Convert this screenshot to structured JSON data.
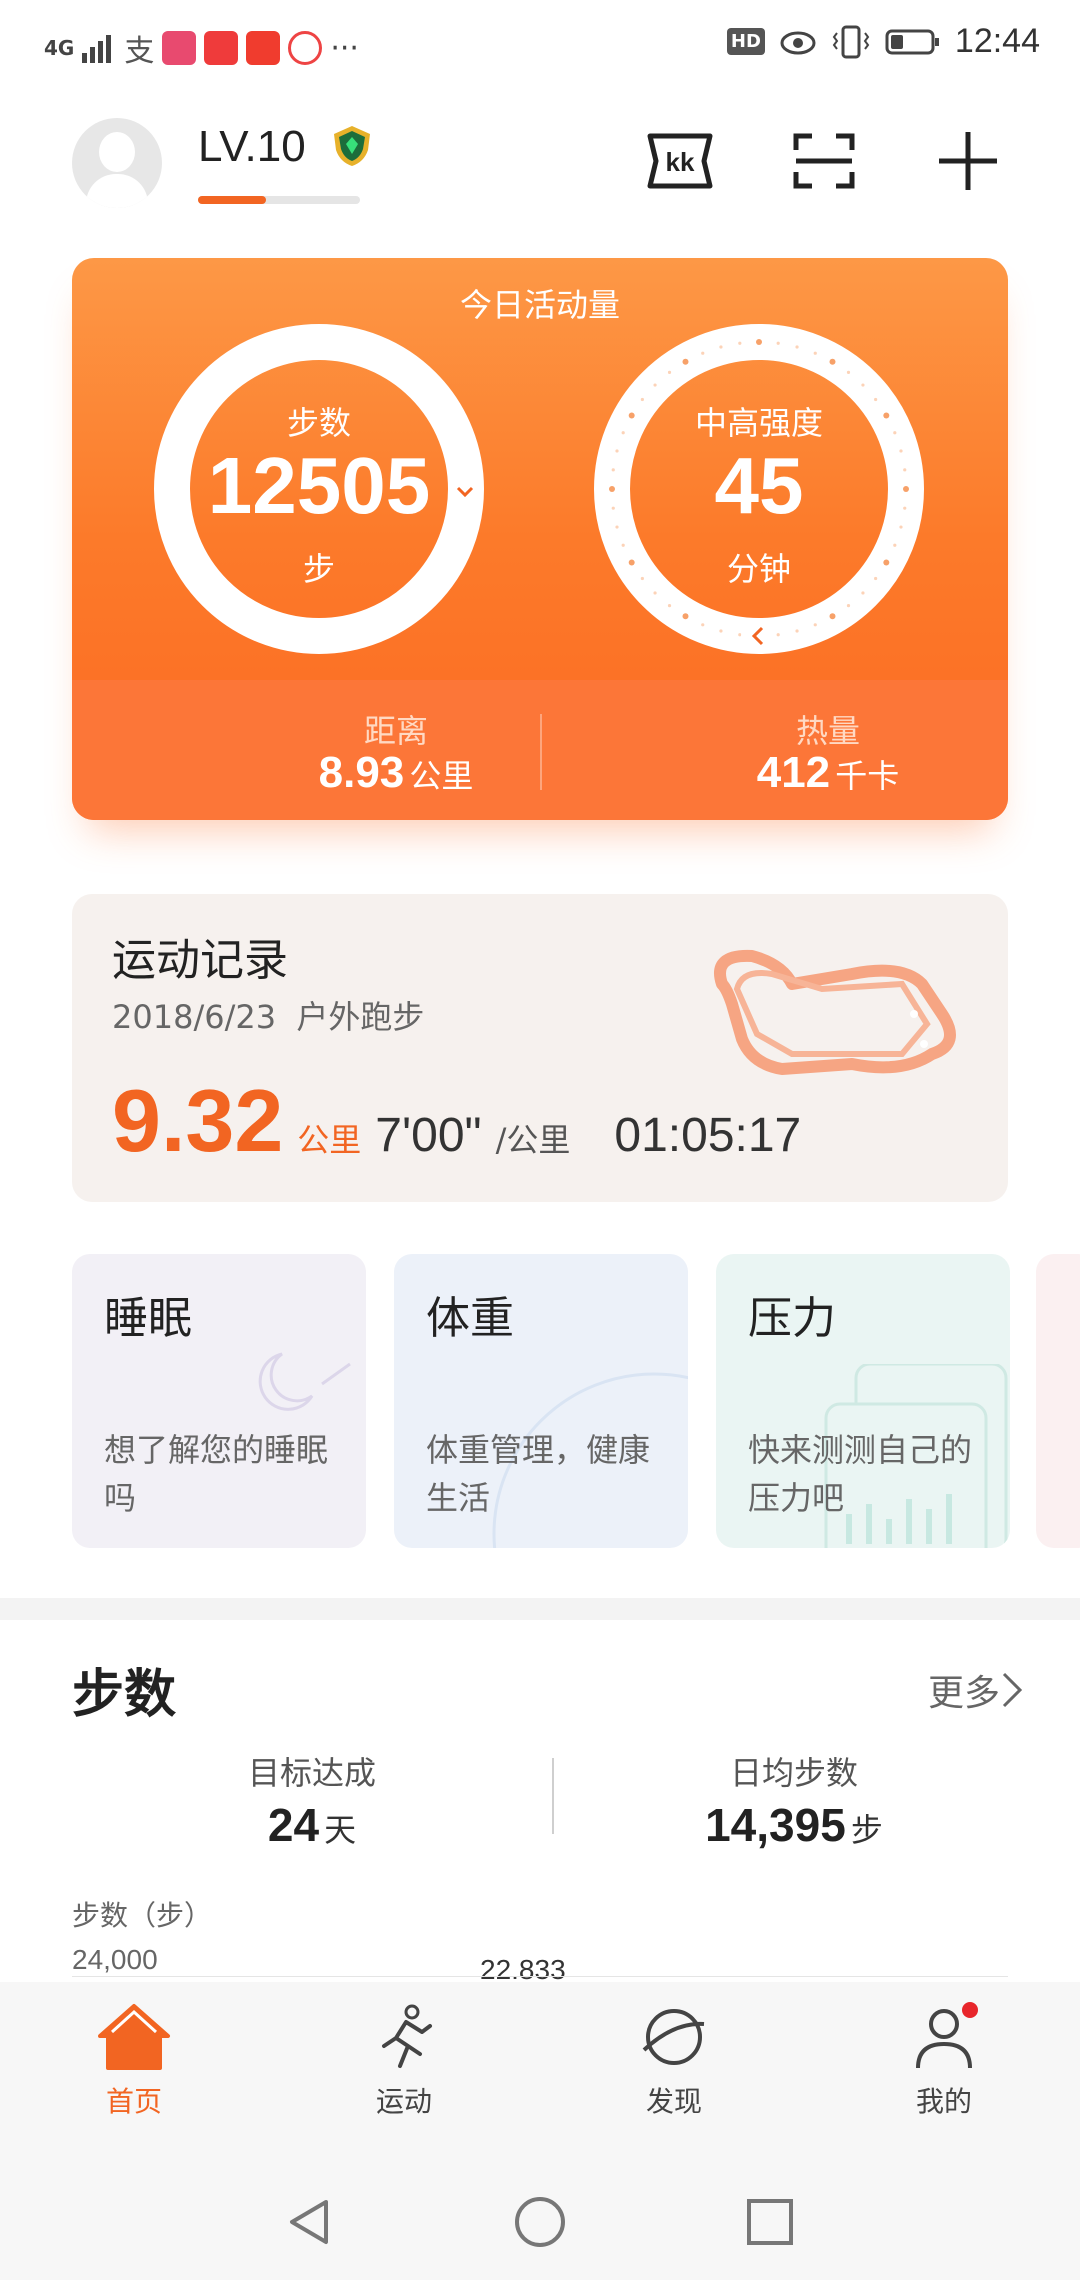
{
  "status_bar": {
    "network": "4G",
    "time": "12:44",
    "hd_badge": "HD",
    "apps": [
      "alipay-icon",
      "app-icon-red",
      "app-icon-zhang",
      "app-icon-play",
      "app-icon-news"
    ],
    "more": "···"
  },
  "header": {
    "level": "LV.10",
    "level_progress": 0.42,
    "actions": [
      "kk-icon",
      "scan-icon",
      "add-icon"
    ]
  },
  "activity": {
    "title": "今日活动量",
    "steps_label": "步数",
    "steps_value": "12505",
    "steps_unit": "步",
    "intensity_label": "中高强度",
    "intensity_value": "45",
    "intensity_unit": "分钟",
    "distance_label": "距离",
    "distance_value": "8.93",
    "distance_unit": "公里",
    "calories_label": "热量",
    "calories_value": "412",
    "calories_unit": "千卡"
  },
  "record": {
    "title": "运动记录",
    "date": "2018/6/23",
    "type": "户外跑步",
    "distance": "9.32",
    "distance_unit": "公里",
    "pace": "7'00\"",
    "pace_unit": "/公里",
    "duration": "01:05:17"
  },
  "tiles": [
    {
      "title": "睡眠",
      "desc": "想了解您的睡眠吗"
    },
    {
      "title": "体重",
      "desc": "体重管理，健康生活"
    },
    {
      "title": "压力",
      "desc": "快来测测自己的压力吧"
    }
  ],
  "steps_section": {
    "title": "步数",
    "more": "更多",
    "goal_label": "目标达成",
    "goal_value": "24",
    "goal_unit": "天",
    "avg_label": "日均步数",
    "avg_value": "14,395",
    "avg_unit": "步",
    "axis_title": "步数（步）",
    "tick": "24,000",
    "bar_label": "22.833"
  },
  "nav": {
    "items": [
      {
        "label": "首页",
        "icon": "home-icon",
        "active": true
      },
      {
        "label": "运动",
        "icon": "run-icon",
        "active": false
      },
      {
        "label": "发现",
        "icon": "planet-icon",
        "active": false
      },
      {
        "label": "我的",
        "icon": "profile-icon",
        "active": false
      }
    ]
  },
  "colors": {
    "accent": "#f26522",
    "card_gradient_top": "#fd9846",
    "card_gradient_bottom": "#fb6a22"
  }
}
